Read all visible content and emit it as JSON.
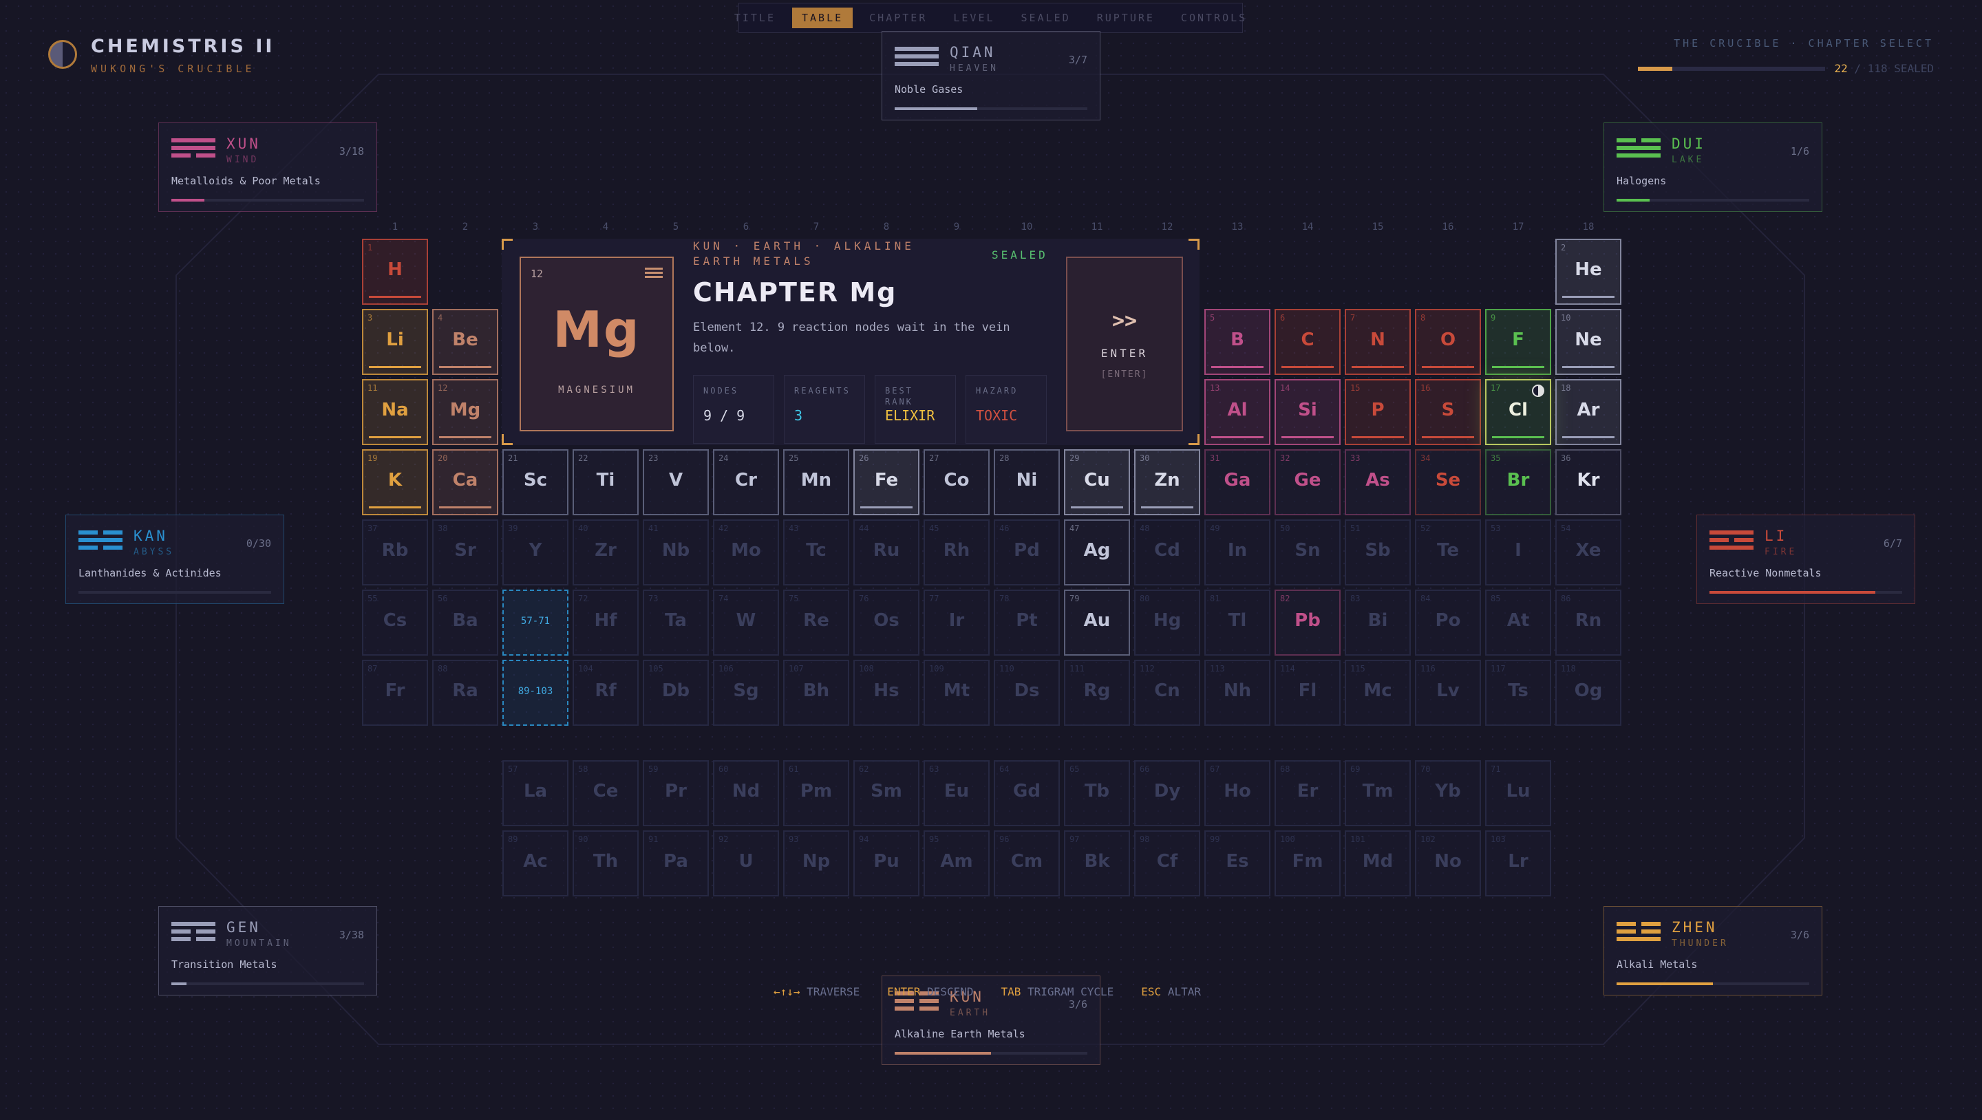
{
  "nav": {
    "tabs": [
      "TITLE",
      "TABLE",
      "CHAPTER",
      "LEVEL",
      "SEALED",
      "RUPTURE",
      "CONTROLS"
    ],
    "active": 1
  },
  "game": {
    "title": "CHEMISTRIS II",
    "subtitle": "WUKONG'S CRUCIBLE"
  },
  "progress": {
    "label": "THE CRUCIBLE · CHAPTER SELECT",
    "sealed": "22",
    "total": "/ 118 SEALED",
    "fraction": 0.186
  },
  "trigrams": [
    {
      "id": "qian",
      "name": "QIAN",
      "english": "HEAVEN",
      "count": "3/7",
      "family": "Noble Gases",
      "fraction": 0.43,
      "color": "#9a9eb8",
      "lines": [
        1,
        1,
        1
      ]
    },
    {
      "id": "xun",
      "name": "XUN",
      "english": "WIND",
      "count": "3/18",
      "family": "Metalloids & Poor Metals",
      "fraction": 0.17,
      "color": "#c0508a",
      "lines": [
        1,
        1,
        0
      ]
    },
    {
      "id": "dui",
      "name": "DUI",
      "english": "LAKE",
      "count": "1/6",
      "family": "Halogens",
      "fraction": 0.17,
      "color": "#5ac050",
      "lines": [
        0,
        1,
        1
      ]
    },
    {
      "id": "kan",
      "name": "KAN",
      "english": "ABYSS",
      "count": "0/30",
      "family": "Lanthanides & Actinides",
      "fraction": 0,
      "color": "#2a90d0",
      "lines": [
        0,
        1,
        0
      ]
    },
    {
      "id": "li",
      "name": "LI",
      "english": "FIRE",
      "count": "6/7",
      "family": "Reactive Nonmetals",
      "fraction": 0.86,
      "color": "#c84a3a",
      "lines": [
        1,
        0,
        1
      ]
    },
    {
      "id": "gen",
      "name": "GEN",
      "english": "MOUNTAIN",
      "count": "3/38",
      "family": "Transition Metals",
      "fraction": 0.08,
      "color": "#9a9eb8",
      "lines": [
        1,
        0,
        0
      ]
    },
    {
      "id": "zhen",
      "name": "ZHEN",
      "english": "THUNDER",
      "count": "3/6",
      "family": "Alkali Metals",
      "fraction": 0.5,
      "color": "#e0a040",
      "lines": [
        0,
        0,
        1
      ]
    },
    {
      "id": "kun",
      "name": "KUN",
      "english": "EARTH",
      "count": "3/6",
      "family": "Alkaline Earth Metals",
      "fraction": 0.5,
      "color": "#c0826a",
      "lines": [
        0,
        0,
        0
      ]
    }
  ],
  "groups": [
    "1",
    "2",
    "3",
    "4",
    "5",
    "6",
    "7",
    "8",
    "9",
    "10",
    "11",
    "12",
    "13",
    "14",
    "15",
    "16",
    "17",
    "18"
  ],
  "cat_colors": {
    "alk": "#e0a040",
    "ae": "#c0826a",
    "tm": "#9a9eb8",
    "pm": "#c0508a",
    "rn": "#c84a3a",
    "hal": "#5ac050",
    "ng": "#9a9eb8"
  },
  "elements": [
    {
      "n": "1",
      "s": "H",
      "g": 1,
      "p": 1,
      "c": "rn",
      "st": "s"
    },
    {
      "n": "2",
      "s": "He",
      "g": 18,
      "p": 1,
      "c": "ng",
      "st": "s"
    },
    {
      "n": "3",
      "s": "Li",
      "g": 1,
      "p": 2,
      "c": "alk",
      "st": "s"
    },
    {
      "n": "4",
      "s": "Be",
      "g": 2,
      "p": 2,
      "c": "ae",
      "st": "s"
    },
    {
      "n": "5",
      "s": "B",
      "g": 13,
      "p": 2,
      "c": "pm",
      "st": "s"
    },
    {
      "n": "6",
      "s": "C",
      "g": 14,
      "p": 2,
      "c": "rn",
      "st": "s"
    },
    {
      "n": "7",
      "s": "N",
      "g": 15,
      "p": 2,
      "c": "rn",
      "st": "s"
    },
    {
      "n": "8",
      "s": "O",
      "g": 16,
      "p": 2,
      "c": "rn",
      "st": "s"
    },
    {
      "n": "9",
      "s": "F",
      "g": 17,
      "p": 2,
      "c": "hal",
      "st": "s"
    },
    {
      "n": "10",
      "s": "Ne",
      "g": 18,
      "p": 2,
      "c": "ng",
      "st": "s"
    },
    {
      "n": "11",
      "s": "Na",
      "g": 1,
      "p": 3,
      "c": "alk",
      "st": "s"
    },
    {
      "n": "12",
      "s": "Mg",
      "g": 2,
      "p": 3,
      "c": "ae",
      "st": "s"
    },
    {
      "n": "13",
      "s": "Al",
      "g": 13,
      "p": 3,
      "c": "pm",
      "st": "s"
    },
    {
      "n": "14",
      "s": "Si",
      "g": 14,
      "p": 3,
      "c": "pm",
      "st": "s"
    },
    {
      "n": "15",
      "s": "P",
      "g": 15,
      "p": 3,
      "c": "rn",
      "st": "s"
    },
    {
      "n": "16",
      "s": "S",
      "g": 16,
      "p": 3,
      "c": "rn",
      "st": "s"
    },
    {
      "n": "17",
      "s": "Cl",
      "g": 17,
      "p": 3,
      "c": "hal",
      "st": "cur"
    },
    {
      "n": "18",
      "s": "Ar",
      "g": 18,
      "p": 3,
      "c": "ng",
      "st": "s"
    },
    {
      "n": "19",
      "s": "K",
      "g": 1,
      "p": 4,
      "c": "alk",
      "st": "s"
    },
    {
      "n": "20",
      "s": "Ca",
      "g": 2,
      "p": 4,
      "c": "ae",
      "st": "s"
    },
    {
      "n": "21",
      "s": "Sc",
      "g": 3,
      "p": 4,
      "c": "tm",
      "st": "o"
    },
    {
      "n": "22",
      "s": "Ti",
      "g": 4,
      "p": 4,
      "c": "tm",
      "st": "o"
    },
    {
      "n": "23",
      "s": "V",
      "g": 5,
      "p": 4,
      "c": "tm",
      "st": "o"
    },
    {
      "n": "24",
      "s": "Cr",
      "g": 6,
      "p": 4,
      "c": "tm",
      "st": "o"
    },
    {
      "n": "25",
      "s": "Mn",
      "g": 7,
      "p": 4,
      "c": "tm",
      "st": "o"
    },
    {
      "n": "26",
      "s": "Fe",
      "g": 8,
      "p": 4,
      "c": "tm",
      "st": "s"
    },
    {
      "n": "27",
      "s": "Co",
      "g": 9,
      "p": 4,
      "c": "tm",
      "st": "o"
    },
    {
      "n": "28",
      "s": "Ni",
      "g": 10,
      "p": 4,
      "c": "tm",
      "st": "o"
    },
    {
      "n": "29",
      "s": "Cu",
      "g": 11,
      "p": 4,
      "c": "tm",
      "st": "s"
    },
    {
      "n": "30",
      "s": "Zn",
      "g": 12,
      "p": 4,
      "c": "tm",
      "st": "s"
    },
    {
      "n": "31",
      "s": "Ga",
      "g": 13,
      "p": 4,
      "c": "pm",
      "st": "o"
    },
    {
      "n": "32",
      "s": "Ge",
      "g": 14,
      "p": 4,
      "c": "pm",
      "st": "o"
    },
    {
      "n": "33",
      "s": "As",
      "g": 15,
      "p": 4,
      "c": "pm",
      "st": "o"
    },
    {
      "n": "34",
      "s": "Se",
      "g": 16,
      "p": 4,
      "c": "rn",
      "st": "o"
    },
    {
      "n": "35",
      "s": "Br",
      "g": 17,
      "p": 4,
      "c": "hal",
      "st": "o"
    },
    {
      "n": "36",
      "s": "Kr",
      "g": 18,
      "p": 4,
      "c": "ng",
      "st": "o"
    },
    {
      "n": "37",
      "s": "Rb",
      "g": 1,
      "p": 5
    },
    {
      "n": "38",
      "s": "Sr",
      "g": 2,
      "p": 5
    },
    {
      "n": "39",
      "s": "Y",
      "g": 3,
      "p": 5
    },
    {
      "n": "40",
      "s": "Zr",
      "g": 4,
      "p": 5
    },
    {
      "n": "41",
      "s": "Nb",
      "g": 5,
      "p": 5
    },
    {
      "n": "42",
      "s": "Mo",
      "g": 6,
      "p": 5
    },
    {
      "n": "43",
      "s": "Tc",
      "g": 7,
      "p": 5
    },
    {
      "n": "44",
      "s": "Ru",
      "g": 8,
      "p": 5
    },
    {
      "n": "45",
      "s": "Rh",
      "g": 9,
      "p": 5
    },
    {
      "n": "46",
      "s": "Pd",
      "g": 10,
      "p": 5
    },
    {
      "n": "47",
      "s": "Ag",
      "g": 11,
      "p": 5,
      "c": "tm",
      "st": "o"
    },
    {
      "n": "48",
      "s": "Cd",
      "g": 12,
      "p": 5
    },
    {
      "n": "49",
      "s": "In",
      "g": 13,
      "p": 5
    },
    {
      "n": "50",
      "s": "Sn",
      "g": 14,
      "p": 5
    },
    {
      "n": "51",
      "s": "Sb",
      "g": 15,
      "p": 5
    },
    {
      "n": "52",
      "s": "Te",
      "g": 16,
      "p": 5
    },
    {
      "n": "53",
      "s": "I",
      "g": 17,
      "p": 5
    },
    {
      "n": "54",
      "s": "Xe",
      "g": 18,
      "p": 5
    },
    {
      "n": "55",
      "s": "Cs",
      "g": 1,
      "p": 6
    },
    {
      "n": "56",
      "s": "Ba",
      "g": 2,
      "p": 6
    },
    {
      "n": "",
      "s": "57-71",
      "g": 3,
      "p": 6,
      "st": "ref"
    },
    {
      "n": "72",
      "s": "Hf",
      "g": 4,
      "p": 6
    },
    {
      "n": "73",
      "s": "Ta",
      "g": 5,
      "p": 6
    },
    {
      "n": "74",
      "s": "W",
      "g": 6,
      "p": 6
    },
    {
      "n": "75",
      "s": "Re",
      "g": 7,
      "p": 6
    },
    {
      "n": "76",
      "s": "Os",
      "g": 8,
      "p": 6
    },
    {
      "n": "77",
      "s": "Ir",
      "g": 9,
      "p": 6
    },
    {
      "n": "78",
      "s": "Pt",
      "g": 10,
      "p": 6
    },
    {
      "n": "79",
      "s": "Au",
      "g": 11,
      "p": 6,
      "c": "tm",
      "st": "o"
    },
    {
      "n": "80",
      "s": "Hg",
      "g": 12,
      "p": 6
    },
    {
      "n": "81",
      "s": "Tl",
      "g": 13,
      "p": 6
    },
    {
      "n": "82",
      "s": "Pb",
      "g": 14,
      "p": 6,
      "c": "pm",
      "st": "o"
    },
    {
      "n": "83",
      "s": "Bi",
      "g": 15,
      "p": 6
    },
    {
      "n": "84",
      "s": "Po",
      "g": 16,
      "p": 6
    },
    {
      "n": "85",
      "s": "At",
      "g": 17,
      "p": 6
    },
    {
      "n": "86",
      "s": "Rn",
      "g": 18,
      "p": 6
    },
    {
      "n": "87",
      "s": "Fr",
      "g": 1,
      "p": 7
    },
    {
      "n": "88",
      "s": "Ra",
      "g": 2,
      "p": 7
    },
    {
      "n": "",
      "s": "89-103",
      "g": 3,
      "p": 7,
      "st": "ref"
    },
    {
      "n": "104",
      "s": "Rf",
      "g": 4,
      "p": 7
    },
    {
      "n": "105",
      "s": "Db",
      "g": 5,
      "p": 7
    },
    {
      "n": "106",
      "s": "Sg",
      "g": 6,
      "p": 7
    },
    {
      "n": "107",
      "s": "Bh",
      "g": 7,
      "p": 7
    },
    {
      "n": "108",
      "s": "Hs",
      "g": 8,
      "p": 7
    },
    {
      "n": "109",
      "s": "Mt",
      "g": 9,
      "p": 7
    },
    {
      "n": "110",
      "s": "Ds",
      "g": 10,
      "p": 7
    },
    {
      "n": "111",
      "s": "Rg",
      "g": 11,
      "p": 7
    },
    {
      "n": "112",
      "s": "Cn",
      "g": 12,
      "p": 7
    },
    {
      "n": "113",
      "s": "Nh",
      "g": 13,
      "p": 7
    },
    {
      "n": "114",
      "s": "Fl",
      "g": 14,
      "p": 7
    },
    {
      "n": "115",
      "s": "Mc",
      "g": 15,
      "p": 7
    },
    {
      "n": "116",
      "s": "Lv",
      "g": 16,
      "p": 7
    },
    {
      "n": "117",
      "s": "Ts",
      "g": 17,
      "p": 7
    },
    {
      "n": "118",
      "s": "Og",
      "g": 18,
      "p": 7
    },
    {
      "n": "57",
      "s": "La",
      "g": 3,
      "p": 9
    },
    {
      "n": "58",
      "s": "Ce",
      "g": 4,
      "p": 9
    },
    {
      "n": "59",
      "s": "Pr",
      "g": 5,
      "p": 9
    },
    {
      "n": "60",
      "s": "Nd",
      "g": 6,
      "p": 9
    },
    {
      "n": "61",
      "s": "Pm",
      "g": 7,
      "p": 9
    },
    {
      "n": "62",
      "s": "Sm",
      "g": 8,
      "p": 9
    },
    {
      "n": "63",
      "s": "Eu",
      "g": 9,
      "p": 9
    },
    {
      "n": "64",
      "s": "Gd",
      "g": 10,
      "p": 9
    },
    {
      "n": "65",
      "s": "Tb",
      "g": 11,
      "p": 9
    },
    {
      "n": "66",
      "s": "Dy",
      "g": 12,
      "p": 9
    },
    {
      "n": "67",
      "s": "Ho",
      "g": 13,
      "p": 9
    },
    {
      "n": "68",
      "s": "Er",
      "g": 14,
      "p": 9
    },
    {
      "n": "69",
      "s": "Tm",
      "g": 15,
      "p": 9
    },
    {
      "n": "70",
      "s": "Yb",
      "g": 16,
      "p": 9
    },
    {
      "n": "71",
      "s": "Lu",
      "g": 17,
      "p": 9
    },
    {
      "n": "89",
      "s": "Ac",
      "g": 3,
      "p": 10
    },
    {
      "n": "90",
      "s": "Th",
      "g": 4,
      "p": 10
    },
    {
      "n": "91",
      "s": "Pa",
      "g": 5,
      "p": 10
    },
    {
      "n": "92",
      "s": "U",
      "g": 6,
      "p": 10
    },
    {
      "n": "93",
      "s": "Np",
      "g": 7,
      "p": 10
    },
    {
      "n": "94",
      "s": "Pu",
      "g": 8,
      "p": 10
    },
    {
      "n": "95",
      "s": "Am",
      "g": 9,
      "p": 10
    },
    {
      "n": "96",
      "s": "Cm",
      "g": 10,
      "p": 10
    },
    {
      "n": "97",
      "s": "Bk",
      "g": 11,
      "p": 10
    },
    {
      "n": "98",
      "s": "Cf",
      "g": 12,
      "p": 10
    },
    {
      "n": "99",
      "s": "Es",
      "g": 13,
      "p": 10
    },
    {
      "n": "100",
      "s": "Fm",
      "g": 14,
      "p": 10
    },
    {
      "n": "101",
      "s": "Md",
      "g": 15,
      "p": 10
    },
    {
      "n": "102",
      "s": "No",
      "g": 16,
      "p": 10
    },
    {
      "n": "103",
      "s": "Lr",
      "g": 17,
      "p": 10
    }
  ],
  "chapter": {
    "crumb": "KUN · EARTH · ALKALINE EARTH METALS",
    "status": "SEALED",
    "title": "CHAPTER Mg",
    "description": "Element 12. 9 reaction nodes wait in the vein below.",
    "tile": {
      "number": "12",
      "symbol": "Mg",
      "name": "MAGNESIUM"
    },
    "stats": [
      {
        "label": "NODES",
        "value": "9 / 9",
        "color": "#d8dae8"
      },
      {
        "label": "REAGENTS",
        "value": "3",
        "color": "#40c8e8"
      },
      {
        "label": "BEST RANK",
        "value": "ELIXIR",
        "color": "#f0c040"
      },
      {
        "label": "HAZARD",
        "value": "TOXIC",
        "color": "#d05040"
      }
    ],
    "enter": {
      "arrow": ">>",
      "label": "ENTER",
      "key": "[ENTER]"
    }
  },
  "hints": [
    {
      "key": "←↑↓→",
      "label": "TRAVERSE"
    },
    {
      "key": "ENTER",
      "label": "DESCEND"
    },
    {
      "key": "TAB",
      "label": "TRIGRAM CYCLE"
    },
    {
      "key": "ESC",
      "label": "ALTAR"
    }
  ]
}
